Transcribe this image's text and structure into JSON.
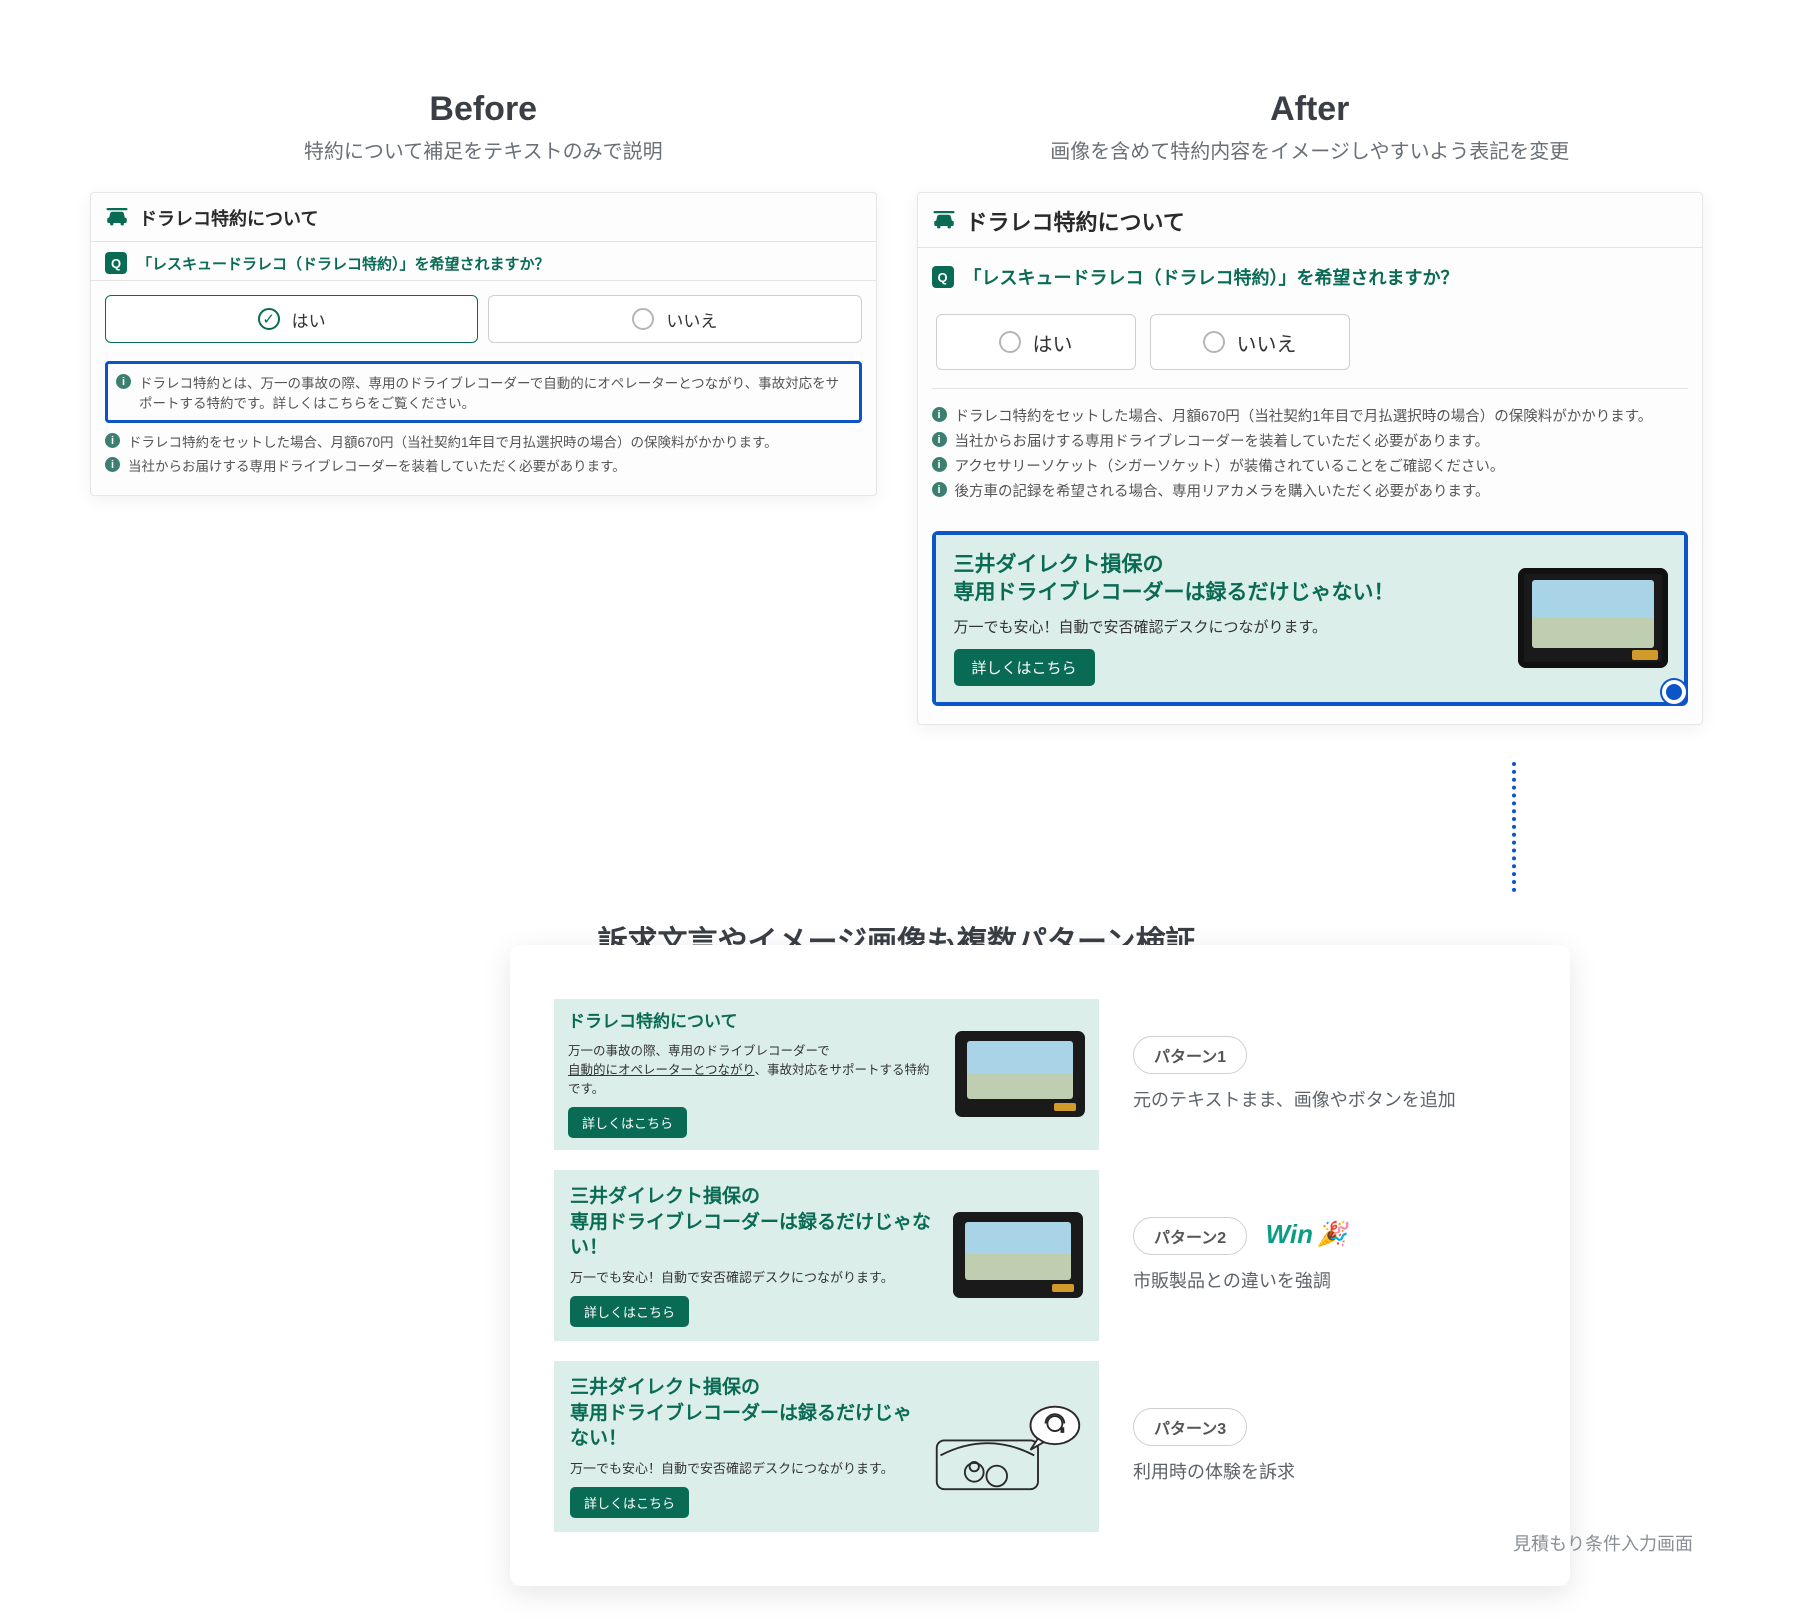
{
  "before": {
    "title": "Before",
    "subtitle": "特約について補足をテキストのみで説明",
    "panel_title": "ドラレコ特約について",
    "q_label": "Q",
    "question": "「レスキュードラレコ（ドラレコ特約）」を希望されますか？",
    "opt_yes": "はい",
    "opt_no": "いいえ",
    "note_highlight": "ドラレコ特約とは、万一の事故の際、専用のドライブレコーダーで自動的にオペレーターとつながり、事故対応をサポートする特約です。詳しくはこちらをご覧ください。",
    "note2": "ドラレコ特約をセットした場合、月額670円（当社契約1年目で月払選択時の場合）の保険料がかかります。",
    "note3": "当社からお届けする専用ドライブレコーダーを装着していただく必要があります。"
  },
  "after": {
    "title": "After",
    "subtitle": "画像を含めて特約内容をイメージしやすいよう表記を変更",
    "panel_title": "ドラレコ特約について",
    "q_label": "Q",
    "question": "「レスキュードラレコ（ドラレコ特約）」を希望されますか？",
    "opt_yes": "はい",
    "opt_no": "いいえ",
    "note1": "ドラレコ特約をセットした場合、月額670円（当社契約1年目で月払選択時の場合）の保険料がかかります。",
    "note2": "当社からお届けする専用ドライブレコーダーを装着していただく必要があります。",
    "note3": "アクセサリーソケット（シガーソケット）が装備されていることをご確認ください。",
    "note4": "後方車の記録を希望される場合、専用リアカメラを購入いただく必要があります。",
    "promo_line1": "三井ダイレクト損保の",
    "promo_line2": "専用ドライブレコーダーは録るだけじゃない！",
    "promo_sub": "万一でも安心！自動で安否確認デスクにつながります。",
    "promo_btn": "詳しくはこちら"
  },
  "lower": {
    "title": "訴求文言やイメージ画像も複数パターン検証",
    "patterns": [
      {
        "pill": "パターン1",
        "desc": "元のテキストまま、画像やボタンを追加",
        "banner_title": "ドラレコ特約について",
        "banner_text_a": "万一の事故の際、専用のドライブレコーダーで",
        "banner_text_b_u": "自動的にオペレーターとつながり",
        "banner_text_c": "、事故対応をサポートする特約です。",
        "btn": "詳しくはこちら",
        "image_type": "dashcam"
      },
      {
        "pill": "パターン2",
        "desc": "市販製品との違いを強調",
        "win": "Win",
        "banner_line1": "三井ダイレクト損保の",
        "banner_line2": "専用ドライブレコーダーは録るだけじゃない！",
        "banner_sub": "万一でも安心！自動で安否確認デスクにつながります。",
        "btn": "詳しくはこちら",
        "image_type": "dashcam"
      },
      {
        "pill": "パターン3",
        "desc": "利用時の体験を訴求",
        "banner_line1": "三井ダイレクト損保の",
        "banner_line2": "専用ドライブレコーダーは録るだけじゃない！",
        "banner_sub": "万一でも安心！自動で安否確認デスクにつながります。",
        "btn": "詳しくはこちら",
        "image_type": "illustration"
      }
    ]
  },
  "footnote": "見積もり条件入力画面"
}
